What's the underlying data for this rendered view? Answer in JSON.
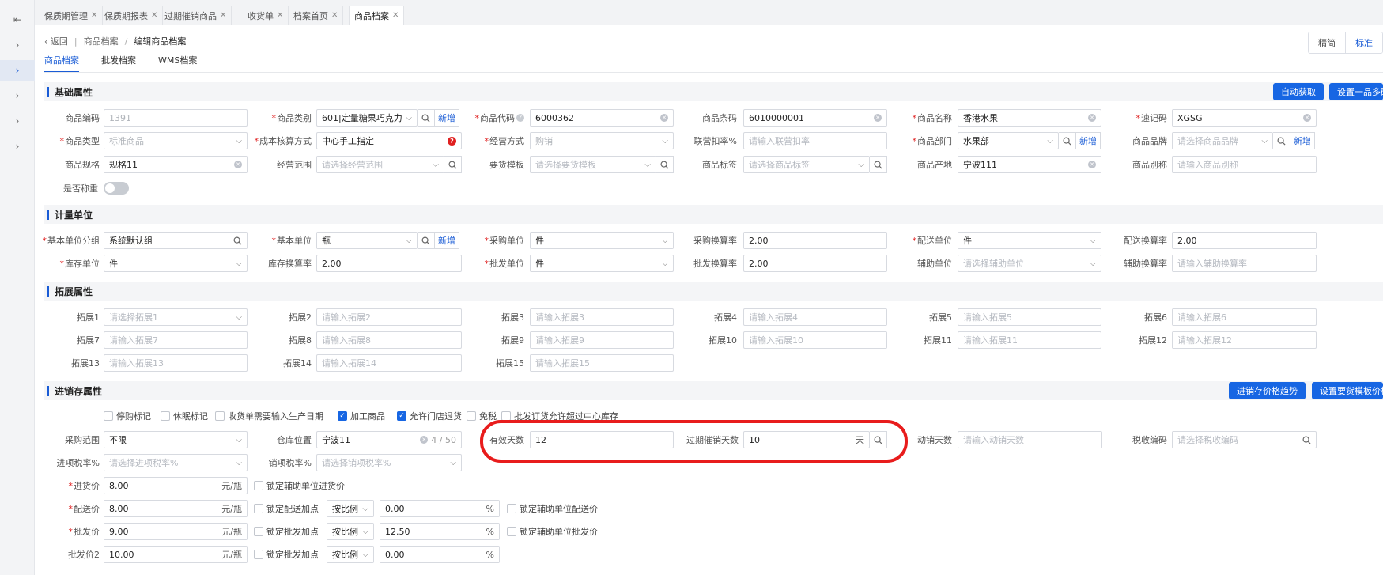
{
  "tabs": [
    "保质期管理",
    "保质期报表",
    "过期催销商品",
    "收货单",
    "档案首页",
    "商品档案"
  ],
  "breadcrumb": {
    "back": "返回",
    "parent": "商品档案",
    "current": "编辑商品档案"
  },
  "view_toggle": {
    "simple": "精简",
    "standard": "标准"
  },
  "subtabs": [
    "商品档案",
    "批发档案",
    "WMS档案"
  ],
  "sections": {
    "basic": "基础属性",
    "unit": "计量单位",
    "ext": "拓展属性",
    "inv": "进销存属性"
  },
  "buttons": {
    "auto_get": "自动获取",
    "set_multi": "设置一品多码",
    "price_trend": "进销存价格趋势",
    "set_template": "设置要货模板价格"
  },
  "basic": {
    "code_l": "商品编码",
    "code_v": "1391",
    "cat_l": "商品类别",
    "cat_v": "601|定量糖果巧克力",
    "pcode_l": "商品代码",
    "pcode_v": "6000362",
    "barcode_l": "商品条码",
    "barcode_v": "6010000001",
    "name_l": "商品名称",
    "name_v": "香港水果",
    "memo_l": "速记码",
    "memo_v": "XGSG",
    "type_l": "商品类型",
    "type_v": "标准商品",
    "cost_l": "成本核算方式",
    "cost_v": "中心手工指定",
    "biz_l": "经营方式",
    "biz_v": "购销",
    "joint_l": "联营扣率%",
    "joint_ph": "请输入联营扣率",
    "dept_l": "商品部门",
    "dept_v": "水果部",
    "brand_l": "商品品牌",
    "brand_ph": "请选择商品品牌",
    "spec_l": "商品规格",
    "spec_v": "规格11",
    "scope_l": "经营范围",
    "scope_ph": "请选择经营范围",
    "tpl_l": "要货模板",
    "tpl_ph": "请选择要货模板",
    "tag_l": "商品标签",
    "tag_ph": "请选择商品标签",
    "origin_l": "商品产地",
    "origin_v": "宁波111",
    "alias_l": "商品别称",
    "alias_ph": "请输入商品别称",
    "weigh_l": "是否称重",
    "new": "新增"
  },
  "unit": {
    "grp_l": "基本单位分组",
    "grp_v": "系统默认组",
    "base_l": "基本单位",
    "base_v": "瓶",
    "pur_l": "采购单位",
    "pur_v": "件",
    "purr_l": "采购换算率",
    "purr_v": "2.00",
    "dist_l": "配送单位",
    "dist_v": "件",
    "distr_l": "配送换算率",
    "distr_v": "2.00",
    "stock_l": "库存单位",
    "stock_v": "件",
    "stockr_l": "库存换算率",
    "stockr_v": "2.00",
    "whole_l": "批发单位",
    "whole_v": "件",
    "wholer_l": "批发换算率",
    "wholer_v": "2.00",
    "aux_l": "辅助单位",
    "aux_ph": "请选择辅助单位",
    "auxr_l": "辅助换算率",
    "auxr_ph": "请输入辅助换算率"
  },
  "ext": [
    {
      "l": "拓展1",
      "ph": "请选择拓展1"
    },
    {
      "l": "拓展2",
      "ph": "请输入拓展2"
    },
    {
      "l": "拓展3",
      "ph": "请输入拓展3"
    },
    {
      "l": "拓展4",
      "ph": "请输入拓展4"
    },
    {
      "l": "拓展5",
      "ph": "请输入拓展5"
    },
    {
      "l": "拓展6",
      "ph": "请输入拓展6"
    },
    {
      "l": "拓展7",
      "ph": "请输入拓展7"
    },
    {
      "l": "拓展8",
      "ph": "请输入拓展8"
    },
    {
      "l": "拓展9",
      "ph": "请输入拓展9"
    },
    {
      "l": "拓展10",
      "ph": "请输入拓展10"
    },
    {
      "l": "拓展11",
      "ph": "请输入拓展11"
    },
    {
      "l": "拓展12",
      "ph": "请输入拓展12"
    },
    {
      "l": "拓展13",
      "ph": "请输入拓展13"
    },
    {
      "l": "拓展14",
      "ph": "请输入拓展14"
    },
    {
      "l": "拓展15",
      "ph": "请输入拓展15"
    }
  ],
  "inv": {
    "checks": [
      "停购标记",
      "休眠标记",
      "收货单需要输入生产日期",
      "加工商品",
      "允许门店退货",
      "免税",
      "批发订货允许超过中心库存"
    ],
    "checked": [
      false,
      false,
      false,
      true,
      true,
      false,
      false
    ],
    "purrange_l": "采购范围",
    "purrange_v": "不限",
    "loc_l": "仓库位置",
    "loc_v": "宁波11",
    "loc_count": "4 / 50",
    "valid_l": "有效天数",
    "valid_v": "12",
    "expire_l": "过期催销天数",
    "expire_v": "10",
    "expire_unit": "天",
    "move_l": "动销天数",
    "move_ph": "请输入动销天数",
    "tax_l": "税收编码",
    "tax_ph": "请选择税收编码",
    "intax_l": "进项税率%",
    "intax_ph": "请选择进项税率%",
    "outtax_l": "销项税率%",
    "outtax_ph": "请选择销项税率%",
    "buyp_l": "进货价",
    "buyp_v": "8.00",
    "distp_l": "配送价",
    "distp_v": "8.00",
    "wholep_l": "批发价",
    "wholep_v": "9.00",
    "wholep2_l": "批发价2",
    "wholep2_v": "10.00",
    "unit": "元/瓶",
    "lock_aux_buy": "锁定辅助单位进货价",
    "lock_dist_add": "锁定配送加点",
    "lock_whole_add": "锁定批发加点",
    "lock_aux_dist": "锁定辅助单位配送价",
    "lock_aux_whole": "锁定辅助单位批发价",
    "ratio": "按比例",
    "dist_add_v": "0.00",
    "whole_add_v": "12.50",
    "whole2_add_v": "0.00",
    "pct": "%"
  }
}
